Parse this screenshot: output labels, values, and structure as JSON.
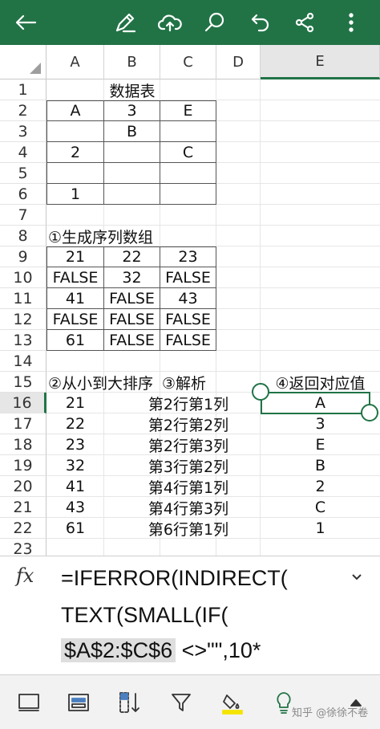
{
  "colors": {
    "accent": "#217346",
    "toolbar_icon": "#ffffff",
    "highlight_yellow": "#f5e400"
  },
  "toolbar": {
    "icons": [
      "back-arrow-icon",
      "pen-icon",
      "cloud-upload-icon",
      "search-icon",
      "undo-icon",
      "share-icon",
      "more-vertical-icon"
    ]
  },
  "sheet": {
    "columns": [
      "A",
      "B",
      "C",
      "D",
      "E"
    ],
    "selected_column": "E",
    "selected_row": "16",
    "rows": [
      "1",
      "2",
      "3",
      "4",
      "5",
      "6",
      "7",
      "8",
      "9",
      "10",
      "11",
      "12",
      "13",
      "14",
      "15",
      "16",
      "17",
      "18",
      "19",
      "20",
      "21",
      "22",
      "23"
    ],
    "cells": {
      "b1": "数据表",
      "a2": "A",
      "b2": "3",
      "c2": "E",
      "b3": "B",
      "a4": "2",
      "c4": "C",
      "a6": "1",
      "a8": "①生成序列数组",
      "a9": "21",
      "b9": "22",
      "c9": "23",
      "a10": "FALSE",
      "b10": "32",
      "c10": "FALSE",
      "a11": "41",
      "b11": "FALSE",
      "c11": "43",
      "a12": "FALSE",
      "b12": "FALSE",
      "c12": "FALSE",
      "a13": "61",
      "b13": "FALSE",
      "c13": "FALSE",
      "a15": "②从小到大排序",
      "c15": "③解析",
      "e15": "④返回对应值",
      "a16": "21",
      "c16": "第2行第1列",
      "e16": "A",
      "a17": "22",
      "c17": "第2行第2列",
      "e17": "3",
      "a18": "23",
      "c18": "第2行第3列",
      "e18": "E",
      "a19": "32",
      "c19": "第3行第2列",
      "e19": "B",
      "a20": "41",
      "c20": "第4行第1列",
      "e20": "2",
      "a21": "43",
      "c21": "第4行第3列",
      "e21": "C",
      "a22": "61",
      "c22": "第6行第1列",
      "e22": "1"
    }
  },
  "formula_bar": {
    "fx_label": "fx",
    "line1": "=IFERROR(INDIRECT(",
    "line2": "TEXT(SMALL(IF(",
    "line3_ref": "$A$2:$C$6",
    "line3_rest": " <>\"\",10*",
    "expand_icon": "chevron-down-icon"
  },
  "bottom_bar": {
    "icons": [
      "comment-icon",
      "table-format-icon",
      "sort-icon",
      "filter-icon",
      "fill-color-icon",
      "lightbulb-icon",
      "expand-up-icon"
    ],
    "watermark": "知乎 @徐徐不卷"
  }
}
